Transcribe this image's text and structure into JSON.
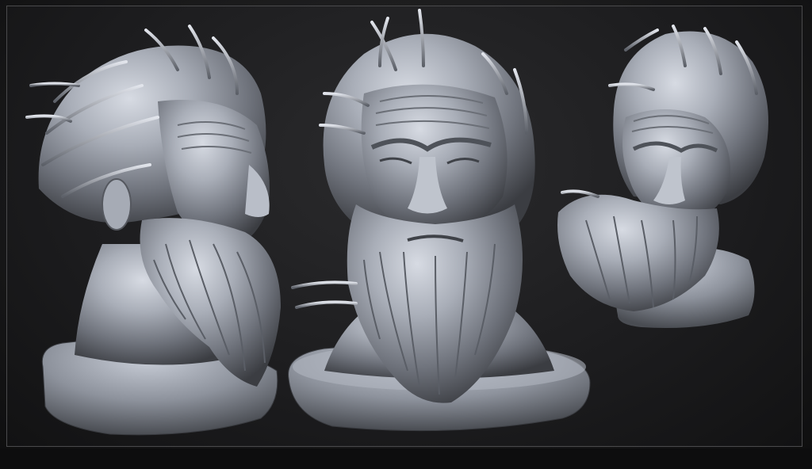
{
  "scene": {
    "background_color": "#1c1c1e",
    "frame_border_color": "#4a4a4c",
    "material_color": "#9aa0ab",
    "views": [
      {
        "name": "side-profile-view",
        "label": ""
      },
      {
        "name": "front-view",
        "label": ""
      },
      {
        "name": "three-quarter-view",
        "label": ""
      }
    ]
  }
}
